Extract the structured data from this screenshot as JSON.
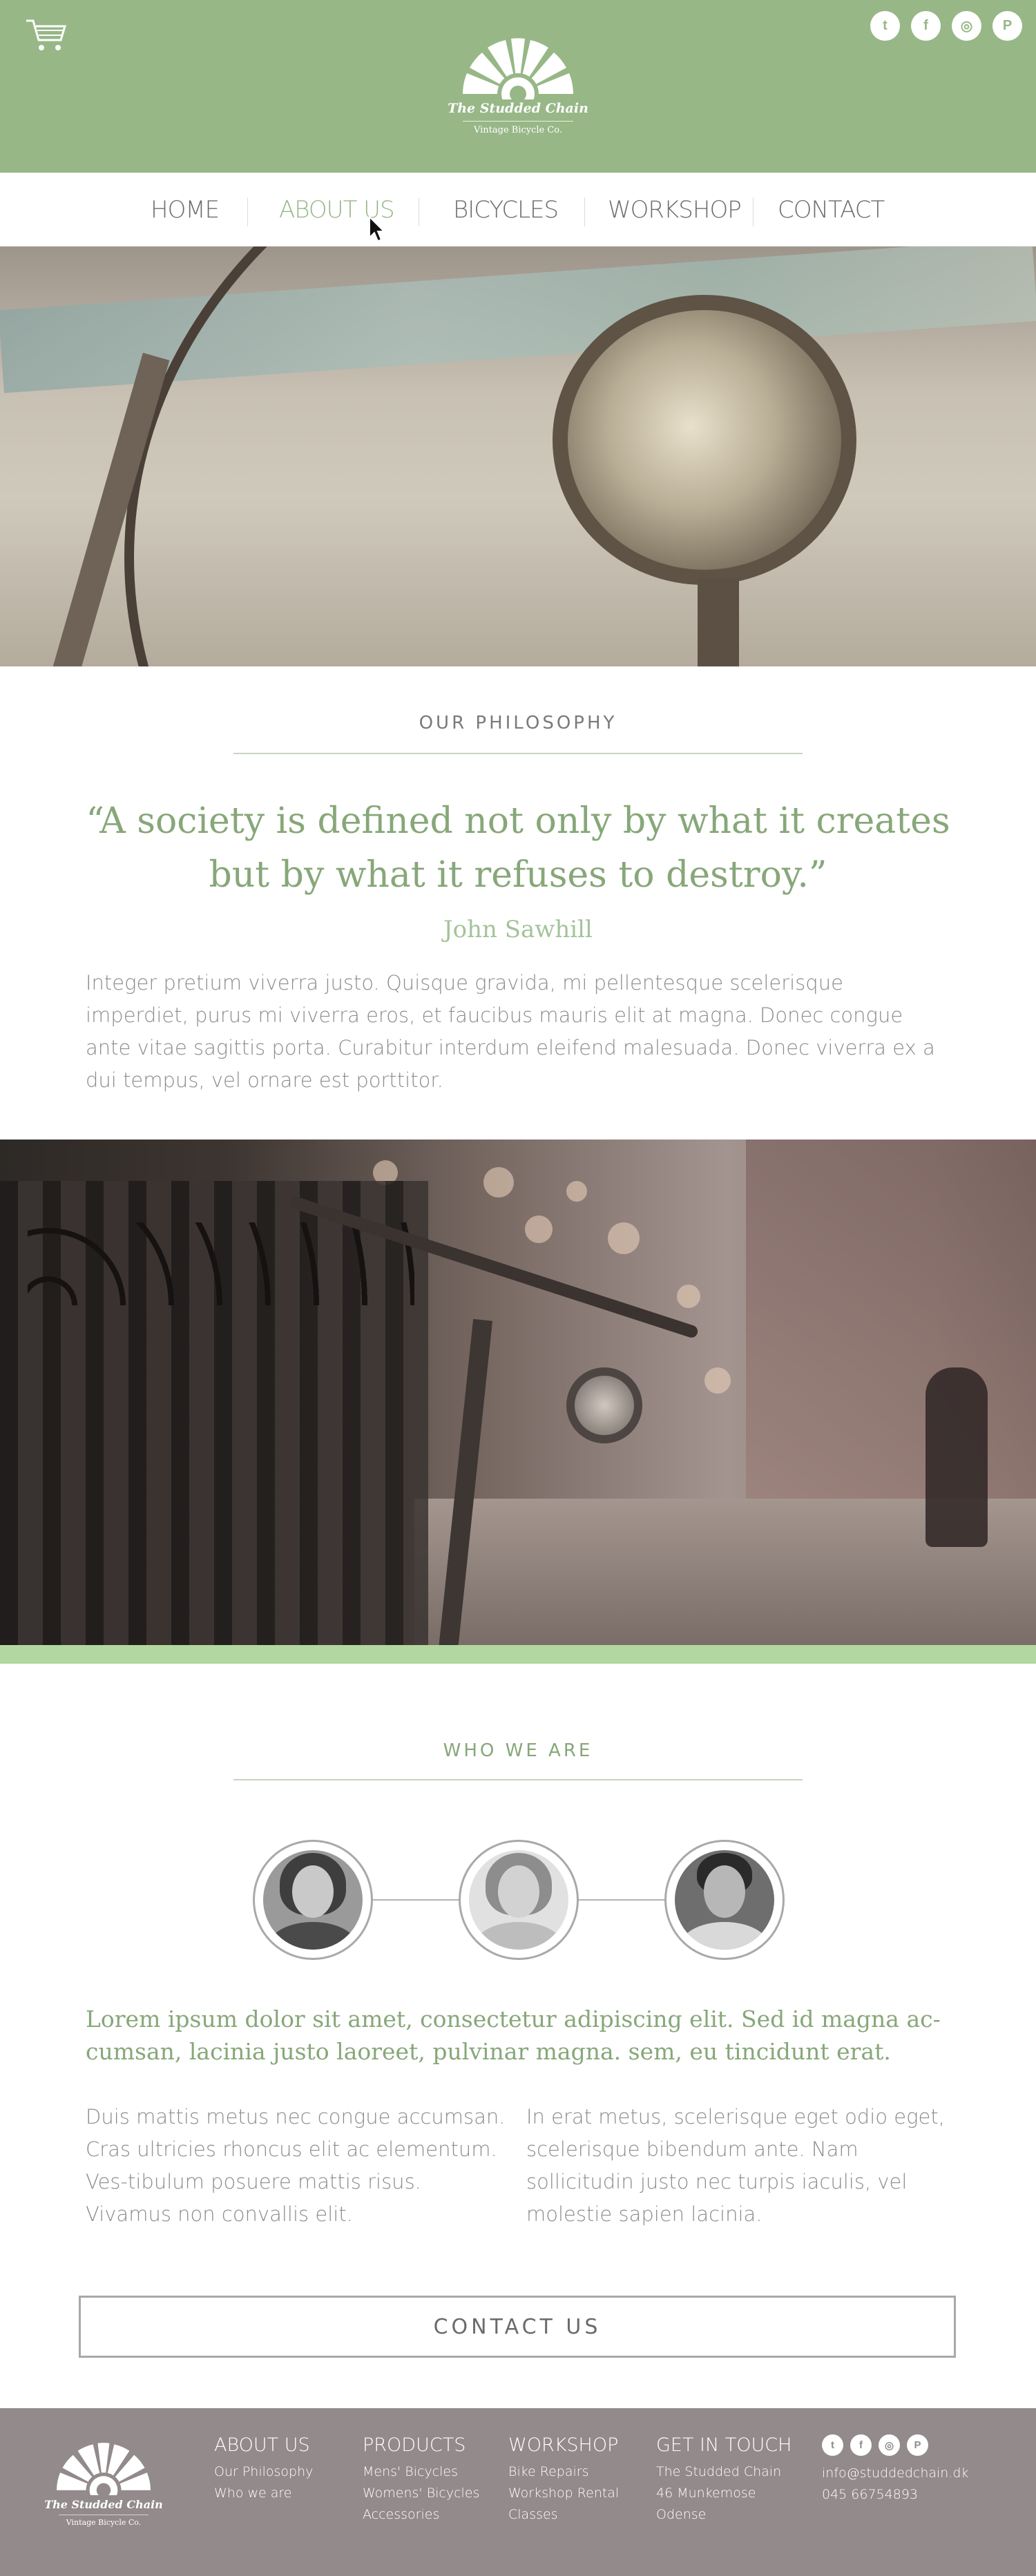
{
  "colors": {
    "brand_green": "#97b787",
    "accent_green": "#87a779",
    "band_green": "#b3d7a0",
    "footer_grey": "#928a8b"
  },
  "header": {
    "logo_name": "The Studded Chain",
    "logo_tagline": "Vintage Bicycle Co.",
    "cart_icon": "cart-icon",
    "social": [
      {
        "icon": "twitter-icon",
        "glyph": "t"
      },
      {
        "icon": "facebook-icon",
        "glyph": "f"
      },
      {
        "icon": "instagram-icon",
        "glyph": "◎"
      },
      {
        "icon": "pinterest-icon",
        "glyph": "P"
      }
    ]
  },
  "nav": {
    "items": [
      {
        "label": "HOME"
      },
      {
        "label": "ABOUT US"
      },
      {
        "label": "BICYCLES"
      },
      {
        "label": "WORKSHOP"
      },
      {
        "label": "CONTACT"
      }
    ],
    "active": "ABOUT US"
  },
  "philosophy": {
    "title": "OUR PHILOSOPHY",
    "quote": "“A society is defined not only by what it creates but by what it refuses to destroy.”",
    "author": "John Sawhill",
    "paragraph": "Integer pretium viverra justo. Quisque gravida, mi pellentesque scelerisque imperdiet, purus mi viverra eros, et faucibus mauris elit at magna. Donec congue ante vitae sagittis porta. Curabitur interdum eleifend malesuada. Donec viverra ex a dui tempus, vel ornare est porttitor."
  },
  "who": {
    "title": "WHO WE ARE",
    "lead": "Lorem ipsum dolor sit amet, consectetur adipiscing elit. Sed id magna ac-cumsan, lacinia justo laoreet, pulvinar magna. sem, eu tincidunt erat.",
    "col_left": "Duis mattis metus nec congue accumsan. Cras ultricies rhoncus elit ac elementum. Ves-tibulum posuere mattis risus. Vivamus non convallis elit.",
    "col_right": "In erat metus, scelerisque eget odio eget, scelerisque bibendum ante. Nam sollicitudin justo nec turpis iaculis, vel molestie sapien lacinia.",
    "button": "CONTACT US"
  },
  "footer": {
    "logo_name": "The Studded Chain",
    "logo_tagline": "Vintage Bicycle Co.",
    "about": {
      "title": "ABOUT US",
      "links": [
        "Our Philosophy",
        "Who we are"
      ]
    },
    "products": {
      "title": "PRODUCTS",
      "links": [
        "Mens' Bicycles",
        "Womens' Bicycles",
        "Accessories"
      ]
    },
    "workshop": {
      "title": "WORKSHOP",
      "links": [
        "Bike Repairs",
        "Workshop Rental",
        "Classes"
      ]
    },
    "touch": {
      "title": "GET IN TOUCH",
      "lines": [
        "The Studded Chain",
        "46 Munkemose",
        "Odense"
      ]
    },
    "contact": {
      "email": "info@studdedchain.dk",
      "phone": "045 66754893"
    }
  }
}
